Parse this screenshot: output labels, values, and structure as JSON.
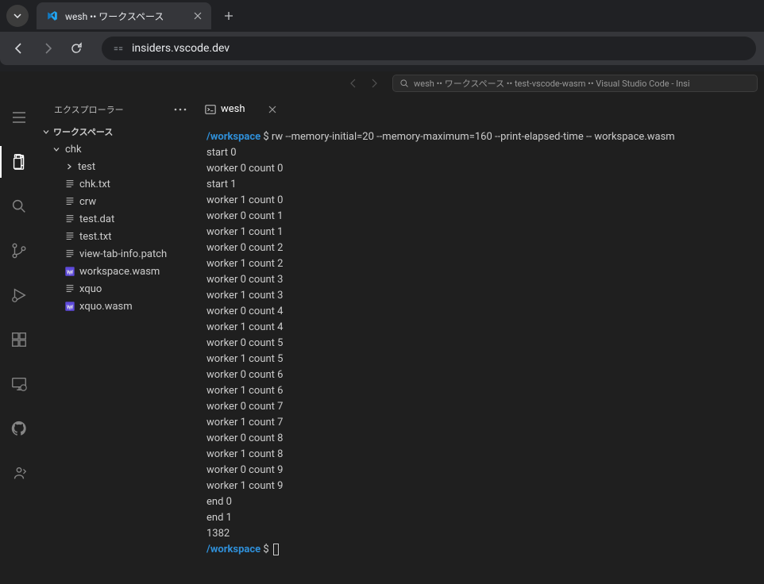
{
  "browser": {
    "tab_title": "wesh •• ワークスペース",
    "url": "insiders.vscode.dev"
  },
  "vscode_title_search": "wesh •• ワークスペース •• test-vscode-wasm •• Visual Studio Code - Insi",
  "sidebar": {
    "title": "エクスプローラー",
    "section": "ワークスペース",
    "tree": [
      {
        "type": "folder",
        "label": "chk",
        "depth": 1,
        "expanded": true
      },
      {
        "type": "folder",
        "label": "test",
        "depth": 2,
        "expanded": false
      },
      {
        "type": "file",
        "label": "chk.txt",
        "depth": 2,
        "icon": "lines"
      },
      {
        "type": "file",
        "label": "crw",
        "depth": 2,
        "icon": "lines"
      },
      {
        "type": "file",
        "label": "test.dat",
        "depth": 2,
        "icon": "lines"
      },
      {
        "type": "file",
        "label": "test.txt",
        "depth": 2,
        "icon": "lines"
      },
      {
        "type": "file",
        "label": "view-tab-info.patch",
        "depth": 2,
        "icon": "lines"
      },
      {
        "type": "file",
        "label": "workspace.wasm",
        "depth": 2,
        "icon": "wasm"
      },
      {
        "type": "file",
        "label": "xquo",
        "depth": 2,
        "icon": "lines"
      },
      {
        "type": "file",
        "label": "xquo.wasm",
        "depth": 2,
        "icon": "wasm"
      }
    ]
  },
  "editor": {
    "tab_label": "wesh"
  },
  "terminal": {
    "prompt_path": "/workspace",
    "prompt_symbol": "$",
    "command": "rw --memory-initial=20 --memory-maximum=160 --print-elapsed-time -- workspace.wasm",
    "output": [
      "start 0",
      "worker 0 count 0",
      "start 1",
      "worker 1 count 0",
      "worker 0 count 1",
      "worker 1 count 1",
      "worker 0 count 2",
      "worker 1 count 2",
      "worker 0 count 3",
      "worker 1 count 3",
      "worker 0 count 4",
      "worker 1 count 4",
      "worker 0 count 5",
      "worker 1 count 5",
      "worker 0 count 6",
      "worker 1 count 6",
      "worker 0 count 7",
      "worker 1 count 7",
      "worker 0 count 8",
      "worker 1 count 8",
      "worker 0 count 9",
      "worker 1 count 9",
      "end 0",
      "end 1",
      "1382"
    ]
  }
}
